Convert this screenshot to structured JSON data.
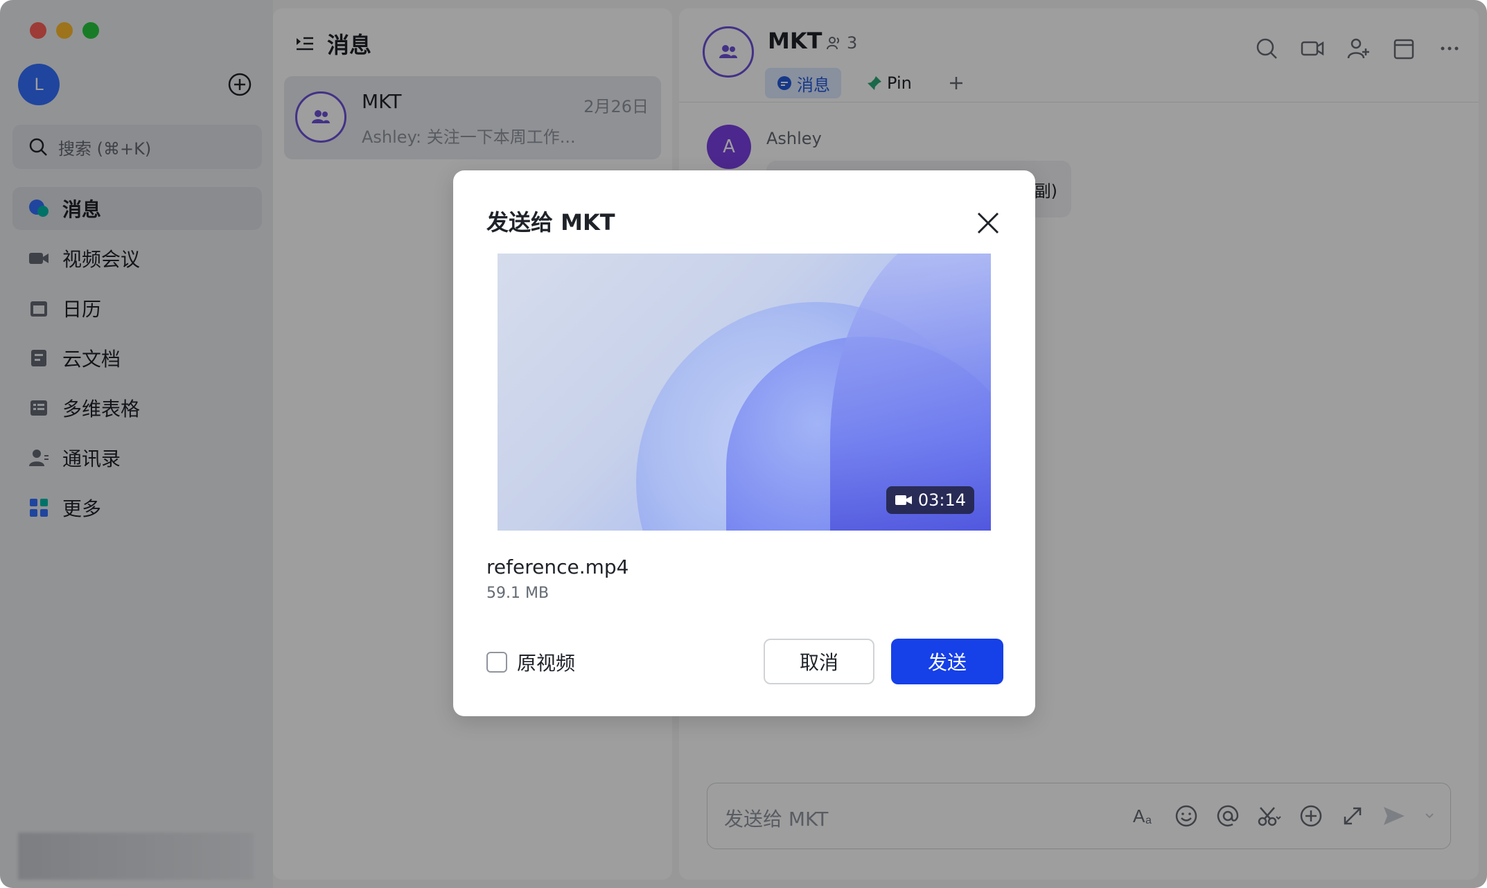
{
  "sidebar": {
    "user_initial": "L",
    "search_placeholder": "搜索 (⌘+K)",
    "items": [
      {
        "label": "消息"
      },
      {
        "label": "视频会议"
      },
      {
        "label": "日历"
      },
      {
        "label": "云文档"
      },
      {
        "label": "多维表格"
      },
      {
        "label": "通讯录"
      },
      {
        "label": "更多"
      }
    ]
  },
  "chatlist": {
    "title": "消息",
    "items": [
      {
        "name": "MKT",
        "date": "2月26日",
        "preview": "Ashley: 关注一下本周工作..."
      }
    ]
  },
  "chat": {
    "title": "MKT",
    "member_count": "3",
    "tabs": [
      {
        "label": "消息"
      },
      {
        "label": "Pin"
      }
    ],
    "message": {
      "sender": "Ashley",
      "avatar_initial": "A",
      "text_fragment": "副)"
    },
    "input_placeholder": "发送给 MKT"
  },
  "modal": {
    "title": "发送给 MKT",
    "duration": "03:14",
    "file_name": "reference.mp4",
    "file_size": "59.1 MB",
    "checkbox_label": "原视频",
    "cancel_label": "取消",
    "send_label": "发送"
  },
  "colors": {
    "accent": "#1640e8",
    "brand_purple": "#6c4fd8",
    "tab_active_bg": "#dde8ff"
  }
}
